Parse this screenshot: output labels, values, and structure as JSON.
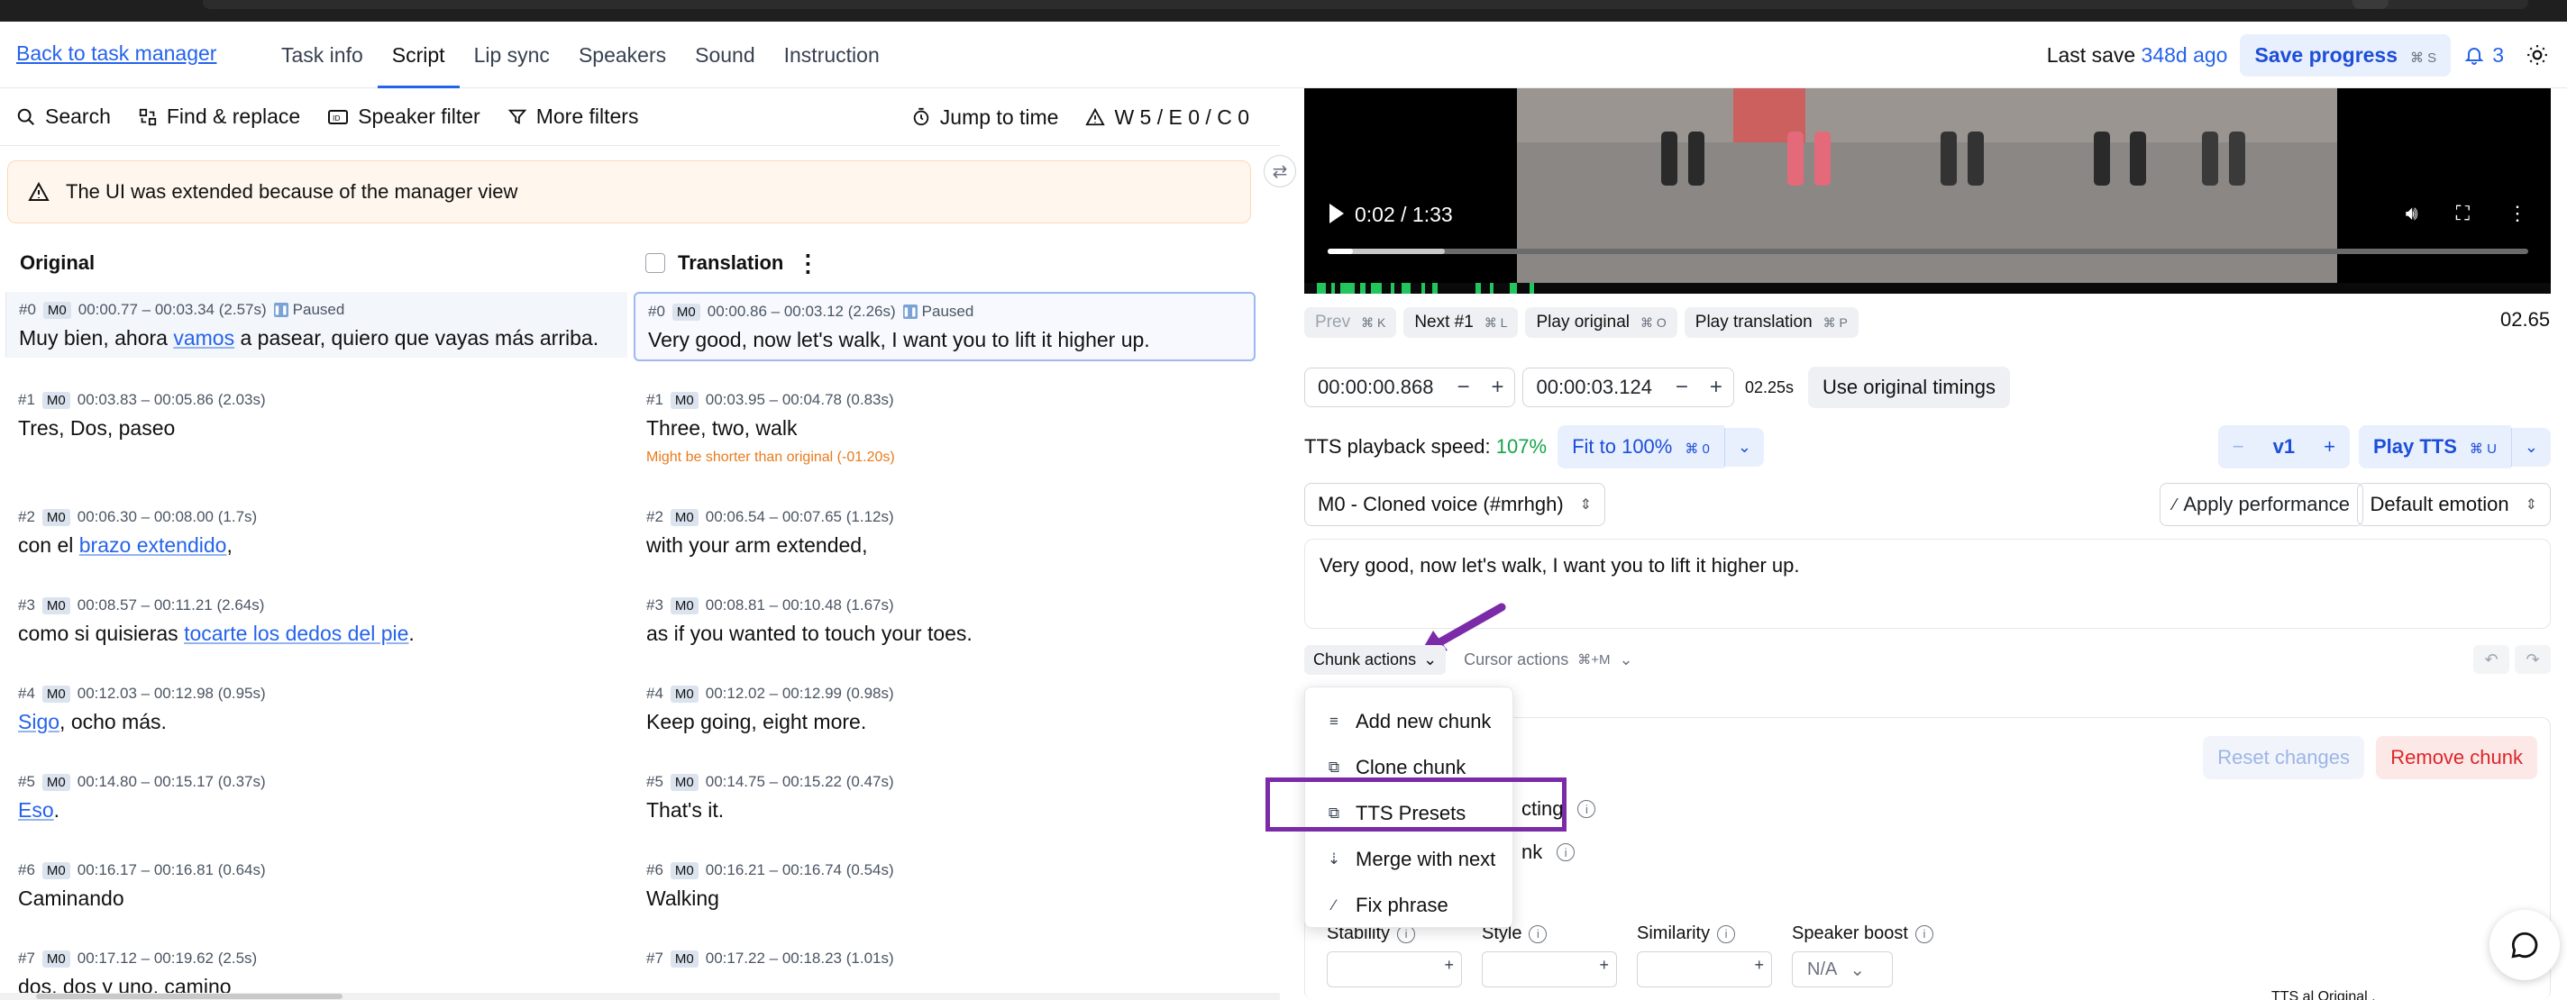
{
  "header": {
    "back_link": "Back to task manager",
    "tabs": [
      "Task info",
      "Script",
      "Lip sync",
      "Speakers",
      "Sound",
      "Instruction"
    ],
    "active_tab": "Script",
    "last_save_label": "Last save",
    "last_save_ago": "348d ago",
    "save_button": "Save progress",
    "save_shortcut": "⌘ S",
    "notifications_count": "3"
  },
  "toolbar": {
    "search": "Search",
    "find_replace": "Find & replace",
    "speaker_filter": "Speaker filter",
    "more_filters": "More filters",
    "jump_to_time": "Jump to time",
    "warnings": "W 5 / E 0 / C 0"
  },
  "notice": "The UI was extended because of the manager view",
  "columns": {
    "original": "Original",
    "translation": "Translation"
  },
  "segments": [
    {
      "o_id": "#0",
      "o_speaker": "M0",
      "o_time": "00:00.77 – 00:03.34 (2.57s)",
      "o_status": "Paused",
      "o_parts": [
        [
          "Muy bien, ahora ",
          false
        ],
        [
          "vamos",
          true
        ],
        [
          " a pasear, quiero que vayas más arriba.",
          false
        ]
      ],
      "t_id": "#0",
      "t_speaker": "M0",
      "t_time": "00:00.86 – 00:03.12 (2.26s)",
      "t_status": "Paused",
      "t_text": "Very good, now let's walk, I want you to lift it higher up.",
      "t_warn": ""
    },
    {
      "o_id": "#1",
      "o_speaker": "M0",
      "o_time": "00:03.83 – 00:05.86 (2.03s)",
      "o_status": "",
      "o_parts": [
        [
          "Tres, Dos, paseo",
          false
        ]
      ],
      "t_id": "#1",
      "t_speaker": "M0",
      "t_time": "00:03.95 – 00:04.78 (0.83s)",
      "t_status": "",
      "t_text": "Three, two, walk",
      "t_warn": "Might be shorter than original (-01.20s)"
    },
    {
      "o_id": "#2",
      "o_speaker": "M0",
      "o_time": "00:06.30 – 00:08.00 (1.7s)",
      "o_status": "",
      "o_parts": [
        [
          "con el ",
          false
        ],
        [
          "brazo extendido",
          true
        ],
        [
          ",",
          false
        ]
      ],
      "t_id": "#2",
      "t_speaker": "M0",
      "t_time": "00:06.54 – 00:07.65 (1.12s)",
      "t_status": "",
      "t_text": "with your arm extended,",
      "t_warn": ""
    },
    {
      "o_id": "#3",
      "o_speaker": "M0",
      "o_time": "00:08.57 – 00:11.21 (2.64s)",
      "o_status": "",
      "o_parts": [
        [
          "como si quisieras ",
          false
        ],
        [
          "tocarte los dedos del pie",
          true
        ],
        [
          ".",
          false
        ]
      ],
      "t_id": "#3",
      "t_speaker": "M0",
      "t_time": "00:08.81 – 00:10.48 (1.67s)",
      "t_status": "",
      "t_text": "as if you wanted to touch your toes.",
      "t_warn": ""
    },
    {
      "o_id": "#4",
      "o_speaker": "M0",
      "o_time": "00:12.03 – 00:12.98 (0.95s)",
      "o_status": "",
      "o_parts": [
        [
          "Sigo",
          true
        ],
        [
          ", ocho más.",
          false
        ]
      ],
      "t_id": "#4",
      "t_speaker": "M0",
      "t_time": "00:12.02 – 00:12.99 (0.98s)",
      "t_status": "",
      "t_text": "Keep going, eight more.",
      "t_warn": ""
    },
    {
      "o_id": "#5",
      "o_speaker": "M0",
      "o_time": "00:14.80 – 00:15.17 (0.37s)",
      "o_status": "",
      "o_parts": [
        [
          "Eso",
          true
        ],
        [
          ".",
          false
        ]
      ],
      "t_id": "#5",
      "t_speaker": "M0",
      "t_time": "00:14.75 – 00:15.22 (0.47s)",
      "t_status": "",
      "t_text": "That's it.",
      "t_warn": ""
    },
    {
      "o_id": "#6",
      "o_speaker": "M0",
      "o_time": "00:16.17 – 00:16.81 (0.64s)",
      "o_status": "",
      "o_parts": [
        [
          "Caminando",
          false
        ]
      ],
      "t_id": "#6",
      "t_speaker": "M0",
      "t_time": "00:16.21 – 00:16.74 (0.54s)",
      "t_status": "",
      "t_text": "Walking",
      "t_warn": ""
    },
    {
      "o_id": "#7",
      "o_speaker": "M0",
      "o_time": "00:17.12 – 00:19.62 (2.5s)",
      "o_status": "",
      "o_parts": [
        [
          "dos, dos y uno, camino",
          false
        ]
      ],
      "t_id": "#7",
      "t_speaker": "M0",
      "t_time": "00:17.22 – 00:18.23 (1.01s)",
      "t_status": "",
      "t_text": "",
      "t_warn": ""
    }
  ],
  "video": {
    "current_time": "0:02 / 1:33",
    "played_fraction": 0.021
  },
  "editor": {
    "time_end": "02.65",
    "nav": [
      {
        "label": "Prev",
        "kbd": "⌘ K",
        "dim": true
      },
      {
        "label": "Next #1",
        "kbd": "⌘ L",
        "dim": false
      },
      {
        "label": "Play original",
        "kbd": "⌘ O",
        "dim": false
      },
      {
        "label": "Play translation",
        "kbd": "⌘ P",
        "dim": false
      }
    ],
    "start_time": "00:00:00.868",
    "end_time": "00:00:03.124",
    "duration": "02.25s",
    "use_original": "Use original timings",
    "speed_label": "TTS playback speed:",
    "speed_value": "107%",
    "fit_button": "Fit to 100%",
    "fit_kbd": "⌘ 0",
    "version": "v1",
    "play_tts": "Play TTS",
    "play_tts_kbd": "⌘ U",
    "voice": "M0 - Cloned voice (#mrhgh)",
    "apply_performance": "Apply performance",
    "emotion": "Default emotion",
    "text": "Very good, now let's walk, I want you to lift it higher up.",
    "chunk_actions": "Chunk actions",
    "cursor_actions": "Cursor actions",
    "cursor_kbd": "⌘+M",
    "reset_changes": "Reset changes",
    "remove_chunk": "Remove chunk",
    "opt1_partial": "cting",
    "opt2_partial": "nk",
    "sliders": [
      "Stability",
      "Style",
      "Similarity"
    ],
    "speaker_boost": "Speaker boost",
    "speaker_boost_value": "N/A"
  },
  "dropdown": [
    "Add new chunk",
    "Clone chunk",
    "TTS Presets",
    "Merge with next",
    "Fix phrase"
  ],
  "bottom_partial": "TTS  al      Original  ."
}
